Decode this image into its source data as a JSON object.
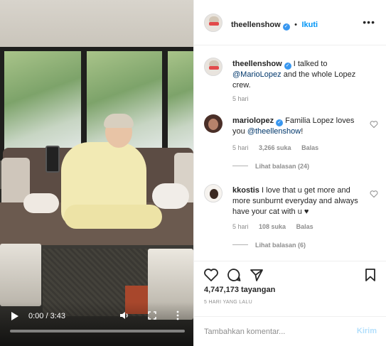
{
  "post": {
    "author": "theellenshow",
    "follow_label": "Ikuti",
    "caption_text": "I talked to",
    "caption_mention": "@MarioLopez",
    "caption_tail": "and the whole Lopez crew.",
    "caption_time": "5 hari"
  },
  "video": {
    "time_display": "0:00 / 3:43",
    "progress_fraction": 0
  },
  "comments": [
    {
      "username": "mariolopez",
      "verified": true,
      "text": "Familia Lopez loves you",
      "mention": "@theellenshow",
      "trailing": "!",
      "time": "5 hari",
      "likes": "3,266 suka",
      "reply": "Balas",
      "view_replies": "Lihat balasan (24)"
    },
    {
      "username": "kkostis",
      "verified": false,
      "text": "I love that u get more and more sunburnt everyday and always have your cat with u ♥",
      "time": "5 hari",
      "likes": "108 suka",
      "reply": "Balas",
      "view_replies": "Lihat balasan (6)"
    }
  ],
  "stats": {
    "views": "4,747,173 tayangan",
    "age": "5 HARI YANG LALU"
  },
  "composer": {
    "placeholder": "Tambahkan komentar...",
    "post_label": "Kirim"
  },
  "colors": {
    "accent": "#0095f6",
    "verified": "#3897f0",
    "post_disabled": "#b2dffc"
  }
}
